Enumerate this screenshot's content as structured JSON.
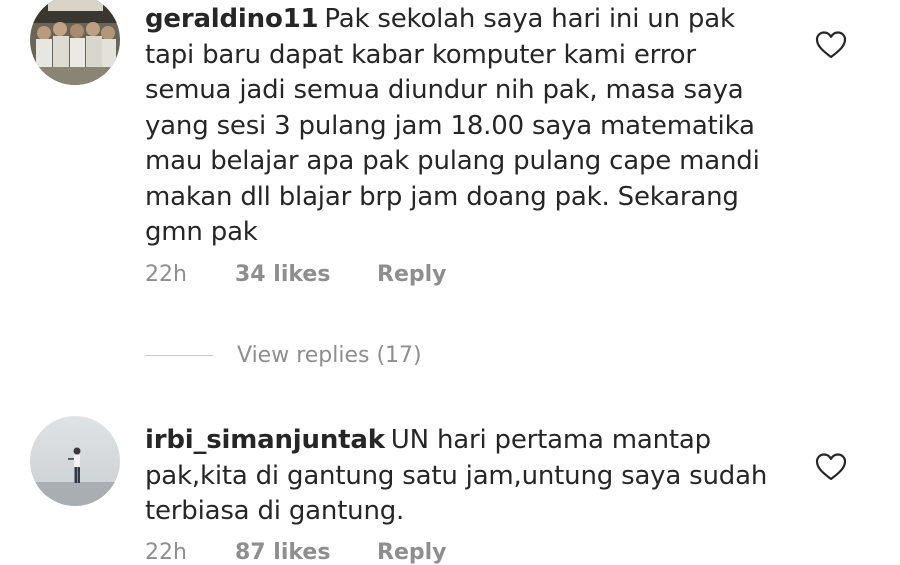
{
  "comments": [
    {
      "username": "geraldino11",
      "text": "Pak sekolah saya hari ini un pak tapi baru dapat kabar komputer kami error semua jadi semua diundur nih pak, masa saya yang sesi 3 pulang jam 18.00 saya matematika mau belajar apa pak pulang pulang cape mandi makan dll blajar brp jam doang pak. Sekarang gmn pak",
      "time": "22h",
      "likes": "34 likes",
      "reply": "Reply",
      "view_replies": "View replies (17)"
    },
    {
      "username": "irbi_simanjuntak",
      "text": "UN hari pertama mantap pak,kita di gantung satu jam,untung saya sudah terbiasa di gantung.",
      "time": "22h",
      "likes": "87 likes",
      "reply": "Reply"
    }
  ],
  "colors": {
    "text": "#262626",
    "secondary": "#8e8e8e",
    "divider": "#c7c7c7"
  }
}
